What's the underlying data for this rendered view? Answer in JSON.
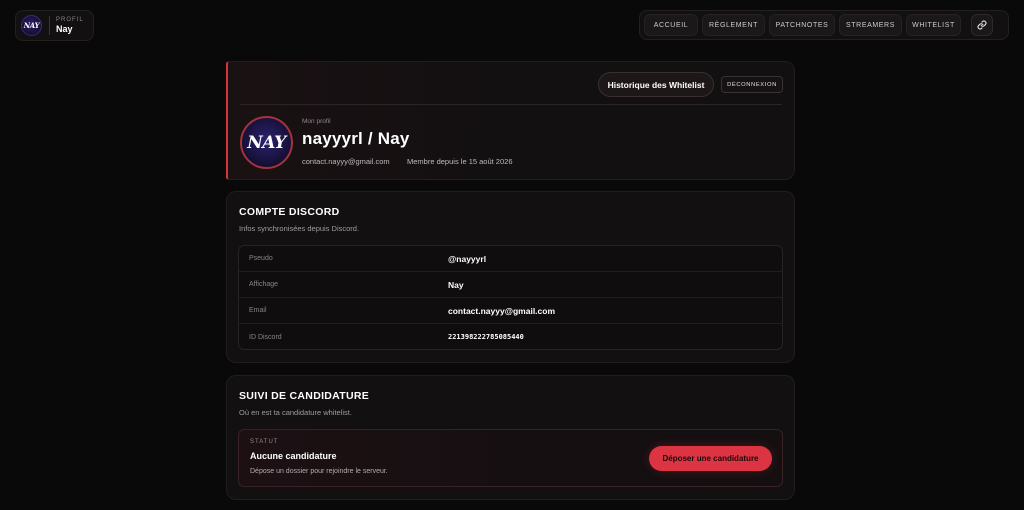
{
  "header": {
    "avatar_text": "NAY",
    "profile_label": "PROFIL",
    "profile_name": "Nay"
  },
  "nav": {
    "items": [
      "ACCUEIL",
      "RÈGLEMENT",
      "PATCHNOTES",
      "STREAMERS",
      "WHITELIST"
    ],
    "link_icon": "link-icon"
  },
  "profile": {
    "history_button": "Historique des Whitelist",
    "logout_button": "DÉCONNEXION",
    "avatar_text": "NAY",
    "label": "Mon profil",
    "title": "nayyyrl / Nay",
    "email": "contact.nayyy@gmail.com",
    "member_since": "Membre depuis le 15 août 2026"
  },
  "discord": {
    "title": "COMPTE DISCORD",
    "subtitle": "Infos synchronisées depuis Discord.",
    "rows": [
      {
        "key": "Pseudo",
        "value": "@nayyyrl"
      },
      {
        "key": "Affichage",
        "value": "Nay"
      },
      {
        "key": "Email",
        "value": "contact.nayyy@gmail.com"
      },
      {
        "key": "ID Discord",
        "value": "221398222785085440"
      }
    ]
  },
  "candidature": {
    "title": "SUIVI DE CANDIDATURE",
    "subtitle": "Où en est ta candidature whitelist.",
    "status_label": "STATUT",
    "status_value": "Aucune candidature",
    "status_desc": "Dépose un dossier pour rejoindre le serveur.",
    "deposit_button": "Déposer une candidature"
  },
  "colors": {
    "accent": "#dc3442",
    "background": "#0a0909",
    "card": "#121011"
  }
}
